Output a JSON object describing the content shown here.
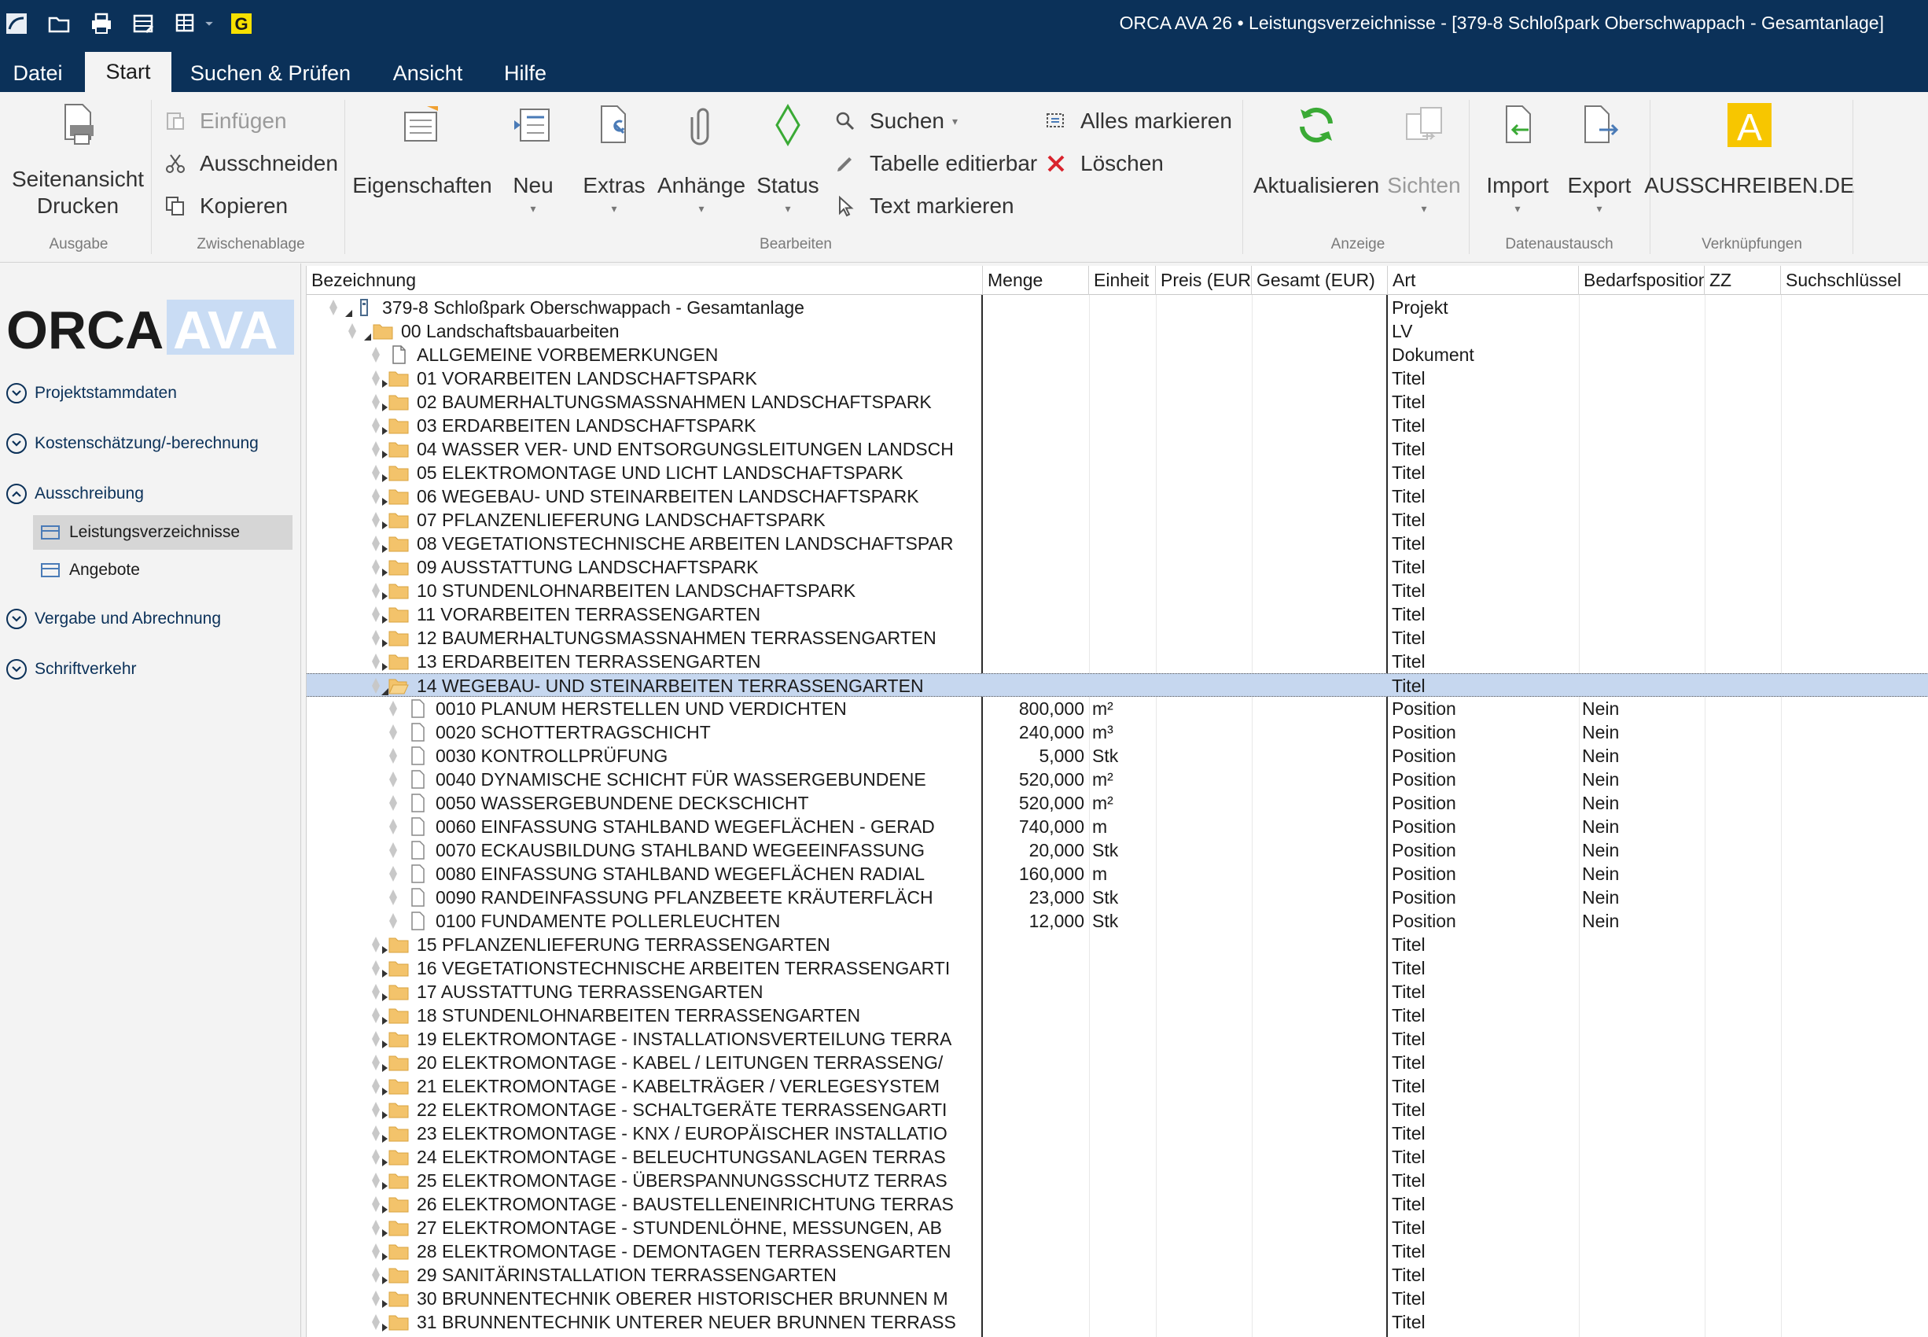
{
  "window": {
    "title": "ORCA AVA 26 • Leistungsverzeichnisse - [379-8 Schloßpark Oberschwappach - Gesamtanlage]"
  },
  "tabs": [
    {
      "label": "Datei"
    },
    {
      "label": "Start"
    },
    {
      "label": "Suchen & Prüfen"
    },
    {
      "label": "Ansicht"
    },
    {
      "label": "Hilfe"
    }
  ],
  "ribbon": {
    "groups": {
      "ausgabe": "Ausgabe",
      "zwischenablage": "Zwischenablage",
      "bearbeiten": "Bearbeiten",
      "anzeige": "Anzeige",
      "datenaustausch": "Datenaustausch",
      "verknuepfungen": "Verknüpfungen"
    },
    "seitenansicht_line1": "Seitenansicht",
    "seitenansicht_line2": "Drucken",
    "einfuegen": "Einfügen",
    "ausschneiden": "Ausschneiden",
    "kopieren": "Kopieren",
    "eigenschaften": "Eigenschaften",
    "neu": "Neu",
    "extras": "Extras",
    "anhaenge": "Anhänge",
    "status": "Status",
    "suchen": "Suchen",
    "tabelle_editierbar": "Tabelle editierbar",
    "text_markieren": "Text markieren",
    "alles_markieren": "Alles markieren",
    "loeschen": "Löschen",
    "aktualisieren": "Aktualisieren",
    "sichten": "Sichten",
    "import": "Import",
    "export": "Export",
    "ausschreiben": "AUSSCHREIBEN.DE",
    "colors": {
      "accent": "#0b3159",
      "refresh": "#3aaa35",
      "delete": "#d9232d",
      "ausschreiben": "#f7c600"
    }
  },
  "nav": {
    "logo_left": "ORCA",
    "logo_right": "AVA",
    "sections": [
      {
        "label": "Projektstammdaten",
        "state": "collapsed"
      },
      {
        "label": "Kostenschätzung/-berechnung",
        "state": "collapsed"
      },
      {
        "label": "Ausschreibung",
        "state": "expanded"
      },
      {
        "label": "Vergabe und Abrechnung",
        "state": "collapsed"
      },
      {
        "label": "Schriftverkehr",
        "state": "collapsed"
      }
    ],
    "items": [
      {
        "label": "Leistungsverzeichnisse",
        "active": true
      },
      {
        "label": "Angebote",
        "active": false
      }
    ]
  },
  "grid": {
    "columns": [
      "Bezeichnung",
      "Menge",
      "Einheit",
      "Preis (EUR",
      "Gesamt (EUR)",
      "Art",
      "Bedarfsposition",
      "ZZ",
      "Suchschlüssel"
    ],
    "rows": [
      {
        "level": 0,
        "type": "project",
        "expander": "open",
        "bez": "379-8 Schloßpark Oberschwappach - Gesamtanlage",
        "menge": "",
        "einheit": "",
        "art": "Projekt",
        "bedarf": ""
      },
      {
        "level": 1,
        "type": "lv",
        "expander": "open",
        "bez": "00 Landschaftsbauarbeiten",
        "menge": "",
        "einheit": "",
        "art": "LV",
        "bedarf": ""
      },
      {
        "level": 2,
        "type": "doc",
        "expander": "none",
        "bez": "ALLGEMEINE VORBEMERKUNGEN",
        "menge": "",
        "einheit": "",
        "art": "Dokument",
        "bedarf": ""
      },
      {
        "level": 2,
        "type": "folder",
        "expander": "closed",
        "bez": "01 VORARBEITEN LANDSCHAFTSPARK",
        "menge": "",
        "einheit": "",
        "art": "Titel",
        "bedarf": ""
      },
      {
        "level": 2,
        "type": "folder",
        "expander": "closed",
        "bez": "02 BAUMERHALTUNGSMASSNAHMEN LANDSCHAFTSPARK",
        "menge": "",
        "einheit": "",
        "art": "Titel",
        "bedarf": ""
      },
      {
        "level": 2,
        "type": "folder",
        "expander": "closed",
        "bez": "03 ERDARBEITEN LANDSCHAFTSPARK",
        "menge": "",
        "einheit": "",
        "art": "Titel",
        "bedarf": ""
      },
      {
        "level": 2,
        "type": "folder",
        "expander": "closed",
        "bez": "04 WASSER VER- UND ENTSORGUNGSLEITUNGEN LANDSCH",
        "menge": "",
        "einheit": "",
        "art": "Titel",
        "bedarf": ""
      },
      {
        "level": 2,
        "type": "folder",
        "expander": "closed",
        "bez": "05 ELEKTROMONTAGE UND LICHT LANDSCHAFTSPARK",
        "menge": "",
        "einheit": "",
        "art": "Titel",
        "bedarf": ""
      },
      {
        "level": 2,
        "type": "folder",
        "expander": "closed",
        "bez": "06 WEGEBAU- UND STEINARBEITEN LANDSCHAFTSPARK",
        "menge": "",
        "einheit": "",
        "art": "Titel",
        "bedarf": ""
      },
      {
        "level": 2,
        "type": "folder",
        "expander": "closed",
        "bez": "07 PFLANZENLIEFERUNG LANDSCHAFTSPARK",
        "menge": "",
        "einheit": "",
        "art": "Titel",
        "bedarf": ""
      },
      {
        "level": 2,
        "type": "folder",
        "expander": "closed",
        "bez": "08 VEGETATIONSTECHNISCHE ARBEITEN LANDSCHAFTSPAR",
        "menge": "",
        "einheit": "",
        "art": "Titel",
        "bedarf": ""
      },
      {
        "level": 2,
        "type": "folder",
        "expander": "closed",
        "bez": "09 AUSSTATTUNG LANDSCHAFTSPARK",
        "menge": "",
        "einheit": "",
        "art": "Titel",
        "bedarf": ""
      },
      {
        "level": 2,
        "type": "folder",
        "expander": "closed",
        "bez": "10 STUNDENLOHNARBEITEN LANDSCHAFTSPARK",
        "menge": "",
        "einheit": "",
        "art": "Titel",
        "bedarf": ""
      },
      {
        "level": 2,
        "type": "folder",
        "expander": "closed",
        "bez": "11 VORARBEITEN TERRASSENGARTEN",
        "menge": "",
        "einheit": "",
        "art": "Titel",
        "bedarf": ""
      },
      {
        "level": 2,
        "type": "folder",
        "expander": "closed",
        "bez": "12 BAUMERHALTUNGSMASSNAHMEN TERRASSENGARTEN",
        "menge": "",
        "einheit": "",
        "art": "Titel",
        "bedarf": ""
      },
      {
        "level": 2,
        "type": "folder",
        "expander": "closed",
        "bez": "13 ERDARBEITEN TERRASSENGARTEN",
        "menge": "",
        "einheit": "",
        "art": "Titel",
        "bedarf": ""
      },
      {
        "level": 2,
        "type": "folder-open",
        "expander": "open",
        "selected": true,
        "bez": "14 WEGEBAU- UND STEINARBEITEN TERRASSENGARTEN",
        "menge": "",
        "einheit": "",
        "art": "Titel",
        "bedarf": ""
      },
      {
        "level": 3,
        "type": "pos",
        "expander": "none",
        "bez": "0010 PLANUM HERSTELLEN UND VERDICHTEN",
        "menge": "800,000",
        "einheit": "m²",
        "art": "Position",
        "bedarf": "Nein"
      },
      {
        "level": 3,
        "type": "pos",
        "expander": "none",
        "bez": "0020 SCHOTTERTRAGSCHICHT",
        "menge": "240,000",
        "einheit": "m³",
        "art": "Position",
        "bedarf": "Nein"
      },
      {
        "level": 3,
        "type": "pos",
        "expander": "none",
        "bez": "0030 KONTROLLPRÜFUNG",
        "menge": "5,000",
        "einheit": "Stk",
        "art": "Position",
        "bedarf": "Nein"
      },
      {
        "level": 3,
        "type": "pos",
        "expander": "none",
        "bez": "0040 DYNAMISCHE SCHICHT FÜR WASSERGEBUNDENE",
        "menge": "520,000",
        "einheit": "m²",
        "art": "Position",
        "bedarf": "Nein"
      },
      {
        "level": 3,
        "type": "pos",
        "expander": "none",
        "bez": "0050 WASSERGEBUNDENE DECKSCHICHT",
        "menge": "520,000",
        "einheit": "m²",
        "art": "Position",
        "bedarf": "Nein"
      },
      {
        "level": 3,
        "type": "pos",
        "expander": "none",
        "bez": "0060 EINFASSUNG STAHLBAND WEGEFLÄCHEN - GERAD",
        "menge": "740,000",
        "einheit": "m",
        "art": "Position",
        "bedarf": "Nein"
      },
      {
        "level": 3,
        "type": "pos",
        "expander": "none",
        "bez": "0070 ECKAUSBILDUNG STAHLBAND WEGEEINFASSUNG",
        "menge": "20,000",
        "einheit": "Stk",
        "art": "Position",
        "bedarf": "Nein"
      },
      {
        "level": 3,
        "type": "pos",
        "expander": "none",
        "bez": "0080 EINFASSUNG STAHLBAND WEGEFLÄCHEN RADIAL",
        "menge": "160,000",
        "einheit": "m",
        "art": "Position",
        "bedarf": "Nein"
      },
      {
        "level": 3,
        "type": "pos",
        "expander": "none",
        "bez": "0090 RANDEINFASSUNG PFLANZBEETE KRÄUTERFLÄCH",
        "menge": "23,000",
        "einheit": "Stk",
        "art": "Position",
        "bedarf": "Nein"
      },
      {
        "level": 3,
        "type": "pos",
        "expander": "none",
        "bez": "0100 FUNDAMENTE POLLERLEUCHTEN",
        "menge": "12,000",
        "einheit": "Stk",
        "art": "Position",
        "bedarf": "Nein"
      },
      {
        "level": 2,
        "type": "folder",
        "expander": "closed",
        "bez": "15 PFLANZENLIEFERUNG TERRASSENGARTEN",
        "menge": "",
        "einheit": "",
        "art": "Titel",
        "bedarf": ""
      },
      {
        "level": 2,
        "type": "folder",
        "expander": "closed",
        "bez": "16 VEGETATIONSTECHNISCHE ARBEITEN TERRASSENGARTI",
        "menge": "",
        "einheit": "",
        "art": "Titel",
        "bedarf": ""
      },
      {
        "level": 2,
        "type": "folder",
        "expander": "closed",
        "bez": "17 AUSSTATTUNG TERRASSENGARTEN",
        "menge": "",
        "einheit": "",
        "art": "Titel",
        "bedarf": ""
      },
      {
        "level": 2,
        "type": "folder",
        "expander": "closed",
        "bez": "18 STUNDENLOHNARBEITEN TERRASSENGARTEN",
        "menge": "",
        "einheit": "",
        "art": "Titel",
        "bedarf": ""
      },
      {
        "level": 2,
        "type": "folder",
        "expander": "closed",
        "bez": "19 ELEKTROMONTAGE - INSTALLATIONSVERTEILUNG TERRA",
        "menge": "",
        "einheit": "",
        "art": "Titel",
        "bedarf": ""
      },
      {
        "level": 2,
        "type": "folder",
        "expander": "closed",
        "bez": "20 ELEKTROMONTAGE - KABEL / LEITUNGEN TERRASSENG/",
        "menge": "",
        "einheit": "",
        "art": "Titel",
        "bedarf": ""
      },
      {
        "level": 2,
        "type": "folder",
        "expander": "closed",
        "bez": "21 ELEKTROMONTAGE - KABELTRÄGER / VERLEGESYSTEM",
        "menge": "",
        "einheit": "",
        "art": "Titel",
        "bedarf": ""
      },
      {
        "level": 2,
        "type": "folder",
        "expander": "closed",
        "bez": "22 ELEKTROMONTAGE - SCHALTGERÄTE TERRASSENGARTI",
        "menge": "",
        "einheit": "",
        "art": "Titel",
        "bedarf": ""
      },
      {
        "level": 2,
        "type": "folder",
        "expander": "closed",
        "bez": "23 ELEKTROMONTAGE - KNX / EUROPÄISCHER INSTALLATIO",
        "menge": "",
        "einheit": "",
        "art": "Titel",
        "bedarf": ""
      },
      {
        "level": 2,
        "type": "folder",
        "expander": "closed",
        "bez": "24 ELEKTROMONTAGE - BELEUCHTUNGSANLAGEN TERRAS",
        "menge": "",
        "einheit": "",
        "art": "Titel",
        "bedarf": ""
      },
      {
        "level": 2,
        "type": "folder",
        "expander": "closed",
        "bez": "25 ELEKTROMONTAGE - ÜBERSPANNUNGSSCHUTZ TERRAS",
        "menge": "",
        "einheit": "",
        "art": "Titel",
        "bedarf": ""
      },
      {
        "level": 2,
        "type": "folder",
        "expander": "closed",
        "bez": "26 ELEKTROMONTAGE - BAUSTELLENEINRICHTUNG TERRAS",
        "menge": "",
        "einheit": "",
        "art": "Titel",
        "bedarf": ""
      },
      {
        "level": 2,
        "type": "folder",
        "expander": "closed",
        "bez": "27 ELEKTROMONTAGE - STUNDENLÖHNE, MESSUNGEN, AB",
        "menge": "",
        "einheit": "",
        "art": "Titel",
        "bedarf": ""
      },
      {
        "level": 2,
        "type": "folder",
        "expander": "closed",
        "bez": "28 ELEKTROMONTAGE - DEMONTAGEN TERRASSENGARTEN",
        "menge": "",
        "einheit": "",
        "art": "Titel",
        "bedarf": ""
      },
      {
        "level": 2,
        "type": "folder",
        "expander": "closed",
        "bez": "29 SANITÄRINSTALLATION TERRASSENGARTEN",
        "menge": "",
        "einheit": "",
        "art": "Titel",
        "bedarf": ""
      },
      {
        "level": 2,
        "type": "folder",
        "expander": "closed",
        "bez": "30 BRUNNENTECHNIK OBERER HISTORISCHER BRUNNEN M",
        "menge": "",
        "einheit": "",
        "art": "Titel",
        "bedarf": ""
      },
      {
        "level": 2,
        "type": "folder",
        "expander": "closed",
        "bez": "31 BRUNNENTECHNIK UNTERER NEUER BRUNNEN TERRASS",
        "menge": "",
        "einheit": "",
        "art": "Titel",
        "bedarf": ""
      }
    ]
  }
}
